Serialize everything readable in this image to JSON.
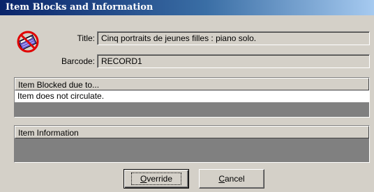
{
  "window": {
    "title": "Item Blocks and Information"
  },
  "icons": {
    "status_icon": "no-circulation-icon"
  },
  "fields": {
    "title_label": "Title:",
    "title_value": "Cinq portraits de jeunes filles : piano solo.",
    "barcode_label": "Barcode:",
    "barcode_value": "RECORD1"
  },
  "blocked_panel": {
    "header": "Item Blocked due to...",
    "rows": [
      "Item does not circulate."
    ]
  },
  "info_panel": {
    "header": "Item Information",
    "rows": []
  },
  "buttons": {
    "override": {
      "mnemonic": "O",
      "rest": "verride"
    },
    "cancel": {
      "mnemonic": "C",
      "rest": "ancel"
    }
  },
  "colors": {
    "titlebar_start": "#0a246a",
    "titlebar_end": "#a6caf0",
    "face": "#d4d0c8",
    "panel_bg": "#808080",
    "icon_red": "#e00000"
  }
}
